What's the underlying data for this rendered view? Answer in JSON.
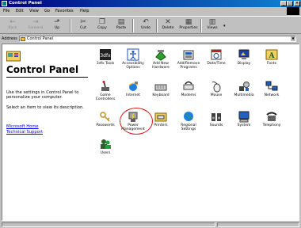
{
  "window": {
    "title": "Control Panel"
  },
  "menu": [
    "File",
    "Edit",
    "View",
    "Go",
    "Favorites",
    "Help"
  ],
  "toolbar": [
    {
      "label": "Back",
      "icon": "back-arrow-icon",
      "disabled": true
    },
    {
      "label": "Forward",
      "icon": "forward-arrow-icon",
      "disabled": true
    },
    {
      "label": "Up",
      "icon": "up-folder-icon",
      "disabled": false
    },
    {
      "label": "Cut",
      "icon": "scissors-icon",
      "disabled": false
    },
    {
      "label": "Copy",
      "icon": "copy-icon",
      "disabled": false
    },
    {
      "label": "Paste",
      "icon": "paste-icon",
      "disabled": false
    },
    {
      "label": "Undo",
      "icon": "undo-icon",
      "disabled": false
    },
    {
      "label": "Delete",
      "icon": "delete-x-icon",
      "disabled": false
    },
    {
      "label": "Properties",
      "icon": "properties-icon",
      "disabled": false
    },
    {
      "label": "Views",
      "icon": "views-icon",
      "disabled": false
    }
  ],
  "address": {
    "label": "Address",
    "value": "Control Panel"
  },
  "sidepanel": {
    "title": "Control Panel",
    "description": "Use the settings in Control Panel to personalize your computer.",
    "select_hint": "Select an item to view its description.",
    "links": [
      "Microsoft Home",
      "Technical Support"
    ]
  },
  "items": [
    {
      "label": "3dfx Tools",
      "icon": "3dfx-icon"
    },
    {
      "label": "Accessibility Options",
      "icon": "accessibility-icon"
    },
    {
      "label": "Add New Hardware",
      "icon": "add-hardware-icon"
    },
    {
      "label": "Add/Remove Programs",
      "icon": "add-remove-programs-icon"
    },
    {
      "label": "Date/Time",
      "icon": "date-time-icon"
    },
    {
      "label": "Display",
      "icon": "display-icon"
    },
    {
      "label": "Fonts",
      "icon": "fonts-icon"
    },
    {
      "label": "Game Controllers",
      "icon": "game-controllers-icon"
    },
    {
      "label": "Internet",
      "icon": "internet-icon"
    },
    {
      "label": "Keyboard",
      "icon": "keyboard-icon"
    },
    {
      "label": "Modems",
      "icon": "modems-icon"
    },
    {
      "label": "Mouse",
      "icon": "mouse-icon"
    },
    {
      "label": "Multimedia",
      "icon": "multimedia-icon"
    },
    {
      "label": "Network",
      "icon": "network-icon"
    },
    {
      "label": "Passwords",
      "icon": "passwords-icon"
    },
    {
      "label": "Power Management",
      "icon": "power-management-icon"
    },
    {
      "label": "Printers",
      "icon": "printers-icon"
    },
    {
      "label": "Regional Settings",
      "icon": "regional-settings-icon"
    },
    {
      "label": "Sounds",
      "icon": "sounds-icon"
    },
    {
      "label": "System",
      "icon": "system-icon"
    },
    {
      "label": "Telephony",
      "icon": "telephony-icon"
    },
    {
      "label": "Users",
      "icon": "users-icon"
    }
  ],
  "colors": {
    "titlebar": "#000080",
    "highlight_circle": "#e01010",
    "link": "#0000ee"
  }
}
